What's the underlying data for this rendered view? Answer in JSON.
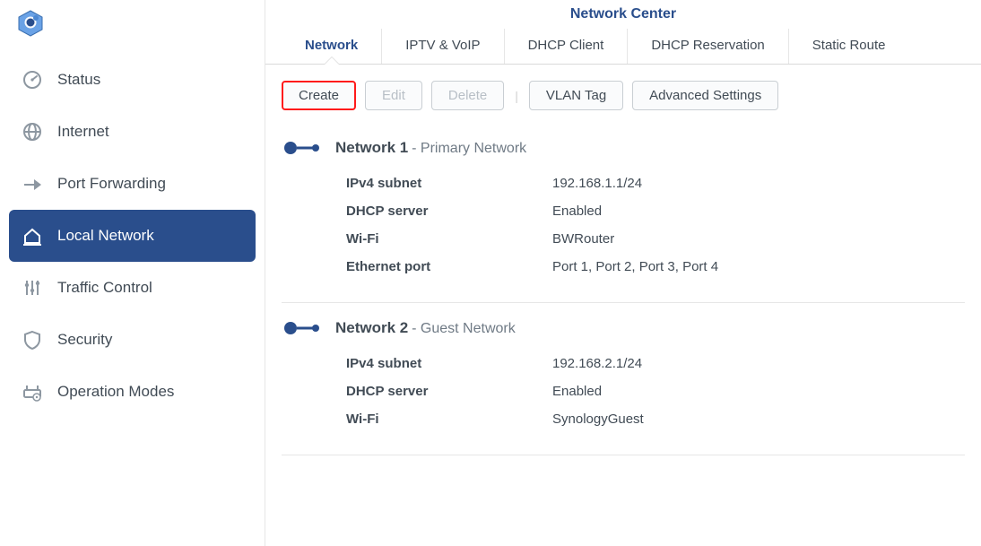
{
  "app_title": "Network Center",
  "sidebar": {
    "items": [
      {
        "label": "Status"
      },
      {
        "label": "Internet"
      },
      {
        "label": "Port Forwarding"
      },
      {
        "label": "Local Network"
      },
      {
        "label": "Traffic Control"
      },
      {
        "label": "Security"
      },
      {
        "label": "Operation Modes"
      }
    ]
  },
  "tabs": [
    {
      "label": "Network"
    },
    {
      "label": "IPTV & VoIP"
    },
    {
      "label": "DHCP Client"
    },
    {
      "label": "DHCP Reservation"
    },
    {
      "label": "Static Route"
    }
  ],
  "toolbar": {
    "create": "Create",
    "edit": "Edit",
    "delete": "Delete",
    "vlan": "VLAN Tag",
    "advanced": "Advanced Settings"
  },
  "networks": [
    {
      "name": "Network 1",
      "role": "Primary Network",
      "rows": [
        {
          "k": "IPv4 subnet",
          "v": "192.168.1.1/24"
        },
        {
          "k": "DHCP server",
          "v": "Enabled"
        },
        {
          "k": "Wi-Fi",
          "v": "BWRouter"
        },
        {
          "k": "Ethernet port",
          "v": "Port 1, Port 2, Port 3, Port 4"
        }
      ]
    },
    {
      "name": "Network 2",
      "role": "Guest Network",
      "rows": [
        {
          "k": "IPv4 subnet",
          "v": "192.168.2.1/24"
        },
        {
          "k": "DHCP server",
          "v": "Enabled"
        },
        {
          "k": "Wi-Fi",
          "v": "SynologyGuest"
        }
      ]
    }
  ]
}
